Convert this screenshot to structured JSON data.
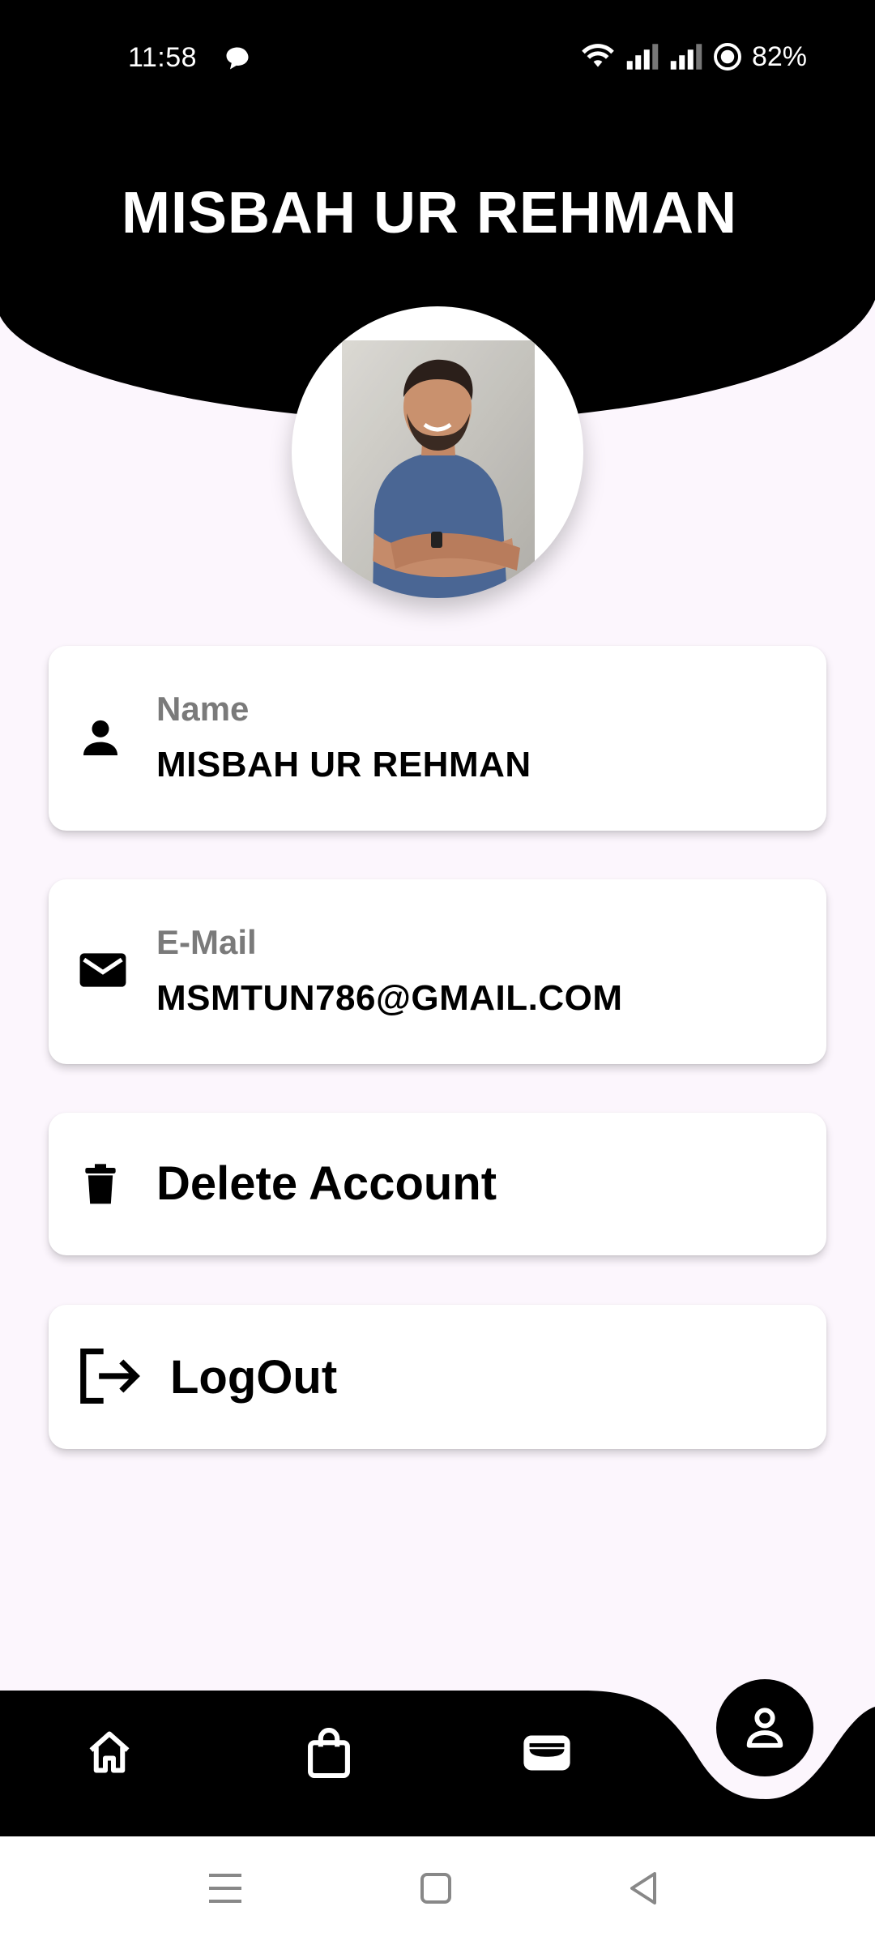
{
  "status_bar": {
    "time": "11:58",
    "battery": "82%"
  },
  "header": {
    "title": "MISBAH UR REHMAN"
  },
  "profile": {
    "avatar_icon": "profile-photo"
  },
  "cards": {
    "name": {
      "icon": "person-icon",
      "label": "Name",
      "value": "MISBAH UR REHMAN"
    },
    "email": {
      "icon": "mail-icon",
      "label": "E-Mail",
      "value": "MSMTUN786@GMAIL.COM"
    },
    "delete": {
      "icon": "trash-icon",
      "label": "Delete Account"
    },
    "logout": {
      "icon": "logout-icon",
      "label": "LogOut"
    }
  },
  "bottom_nav": {
    "items": [
      "home-icon",
      "shopping-bag-icon",
      "wallet-icon",
      "profile-icon"
    ],
    "active": "profile-icon"
  },
  "colors": {
    "header_bg": "#000000",
    "page_bg": "#fcf6fd",
    "card_bg": "#ffffff",
    "label_gray": "#7a7a7a"
  }
}
